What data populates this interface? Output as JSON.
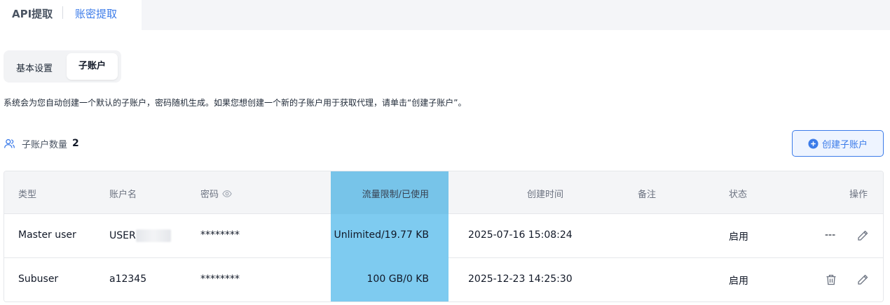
{
  "top_tabs": {
    "api": "API提取",
    "account": "账密提取"
  },
  "segment": {
    "basic": "基本设置",
    "sub": "子账户"
  },
  "description": "系统会为您自动创建一个默认的子账户，密码随机生成。如果您想创建一个新的子账户用于获取代理，请单击“创建子账户”。",
  "count": {
    "label": "子账户数量",
    "value": "2"
  },
  "create_button": "创建子账户",
  "table": {
    "headers": [
      "类型",
      "账户名",
      "密码",
      "流量限制/已使用",
      "创建时间",
      "备注",
      "状态",
      "操作"
    ],
    "rows": [
      {
        "type": "Master user",
        "account": "USER",
        "password": "********",
        "traffic": "Unlimited/19.77 KB",
        "created": "2025-07-16 15:08:24",
        "remark": "",
        "status": "启用",
        "ops_text": "---"
      },
      {
        "type": "Subuser",
        "account": "a12345",
        "password": "********",
        "traffic": "100 GB/0 KB",
        "created": "2025-12-23 14:25:30",
        "remark": "",
        "status": "启用",
        "ops_text": ""
      }
    ]
  },
  "colors": {
    "accent": "#3b7be9",
    "highlight": "#7ecbf0"
  }
}
